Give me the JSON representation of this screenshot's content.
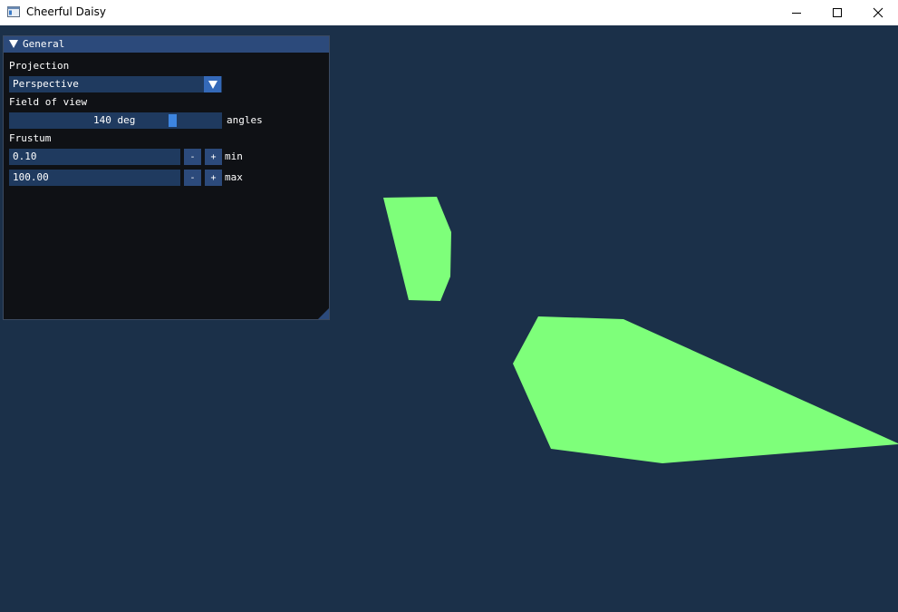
{
  "window": {
    "title": "Cheerful Daisy",
    "icon": "app-window-icon",
    "controls": [
      "minimize-icon",
      "maximize-icon",
      "close-icon"
    ]
  },
  "viewport": {
    "background_color": "#1b3049",
    "shape_color": "#7eff7a"
  },
  "panel": {
    "title": "General",
    "projection": {
      "label": "Projection",
      "selected": "Perspective"
    },
    "fov": {
      "label": "Field of view",
      "value_text": "140 deg",
      "suffix": "angles",
      "value": 140,
      "min": 0,
      "max": 180
    },
    "frustum": {
      "label": "Frustum",
      "min_value": "0.10",
      "min_label": "min",
      "max_value": "100.00",
      "max_label": "max",
      "decrement": "-",
      "increment": "+"
    }
  },
  "colors": {
    "panel_bg": "#0f1115",
    "header_bg": "#2c4a7b",
    "field_bg": "#1f3a5f",
    "accent": "#3d85e0"
  }
}
